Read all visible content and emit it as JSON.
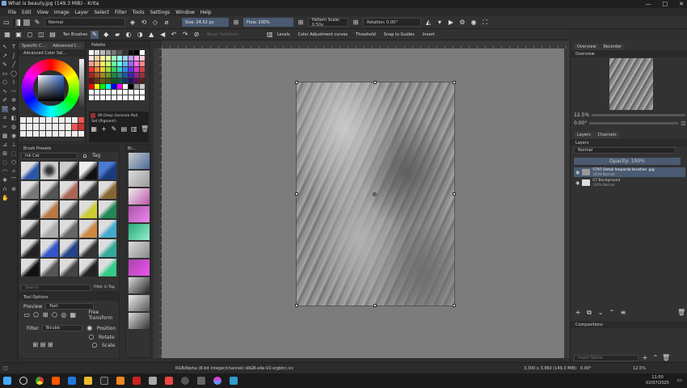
{
  "window": {
    "title": "What is beauty.jpg (149.3 MiB) - Krita",
    "controls": [
      "—",
      "□",
      "✕"
    ]
  },
  "menu": [
    "File",
    "Edit",
    "View",
    "Image",
    "Layer",
    "Select",
    "Filter",
    "Tools",
    "Settings",
    "Window",
    "Help"
  ],
  "toolbar": {
    "blend_mode": "Normal",
    "size": "Size: 24.52 px",
    "flow": "Flow: 100%",
    "pattern_scale": "Pattern Scale: 0.50x",
    "rotation": "Rotation: 0.00°",
    "brushes_label": "Ten Brushes"
  },
  "optionsbar": {
    "items": [
      "Levels",
      "Color Adjustment curves",
      "Threshold",
      "Snap to Guides",
      "Invert"
    ],
    "hidden_label": "Reset Selection"
  },
  "advanced_color": {
    "title": "Advanced Color Sel...",
    "tab2": "Advanced C..."
  },
  "palette": {
    "title": "Palette",
    "color_name": "06 Deep Garanza Red",
    "group": "Set (Pigment)"
  },
  "brush_presets": {
    "title": "Brush Presets",
    "tag_label": "Tag",
    "filter": "Filter in Tag",
    "search_label": "Ink Cat",
    "search_placeholder": "Search"
  },
  "tool_options": {
    "title": "Tool Options",
    "preview_label": "Preview",
    "preview_value": "Fast",
    "free_transform": "Free Transform",
    "filter_label": "Filter",
    "filter_value": "Bicubic",
    "position": "Position",
    "rotate": "Rotate",
    "scale": "Scale"
  },
  "right_panel": {
    "tabs": [
      "Overview",
      "Recorder"
    ],
    "overview_title": "Overview",
    "zoom": "12.5%",
    "angle": "0.00°",
    "layers_tabs": [
      "Layers",
      "Channels"
    ],
    "layers_title": "Layers",
    "blend": "Normal",
    "opacity": "Opacity: 100%",
    "layers": [
      {
        "name": "5797 Detail leopardo brushes .jpg",
        "sub": "100% Normal"
      },
      {
        "name": "07 Background",
        "sub": "100% Normal"
      }
    ],
    "compositions": "Compositions",
    "search_placeholder": "Insert Name"
  },
  "status": {
    "color_info": "RGB/Alpha (8-bit integer/channel)  sRGB-elle-V2-srgbtrc.icc",
    "dims": "3,300 x 3,960 (149.3 MiB)",
    "zoom": "12.5%",
    "angle": "0.00°"
  },
  "taskbar": {
    "time": "11:00",
    "date": "02/07/2025"
  },
  "colors": {
    "accent": "#4a5a72",
    "canvas_bg": "#7c7c7c",
    "palette_selected": "#9a2f2f"
  }
}
